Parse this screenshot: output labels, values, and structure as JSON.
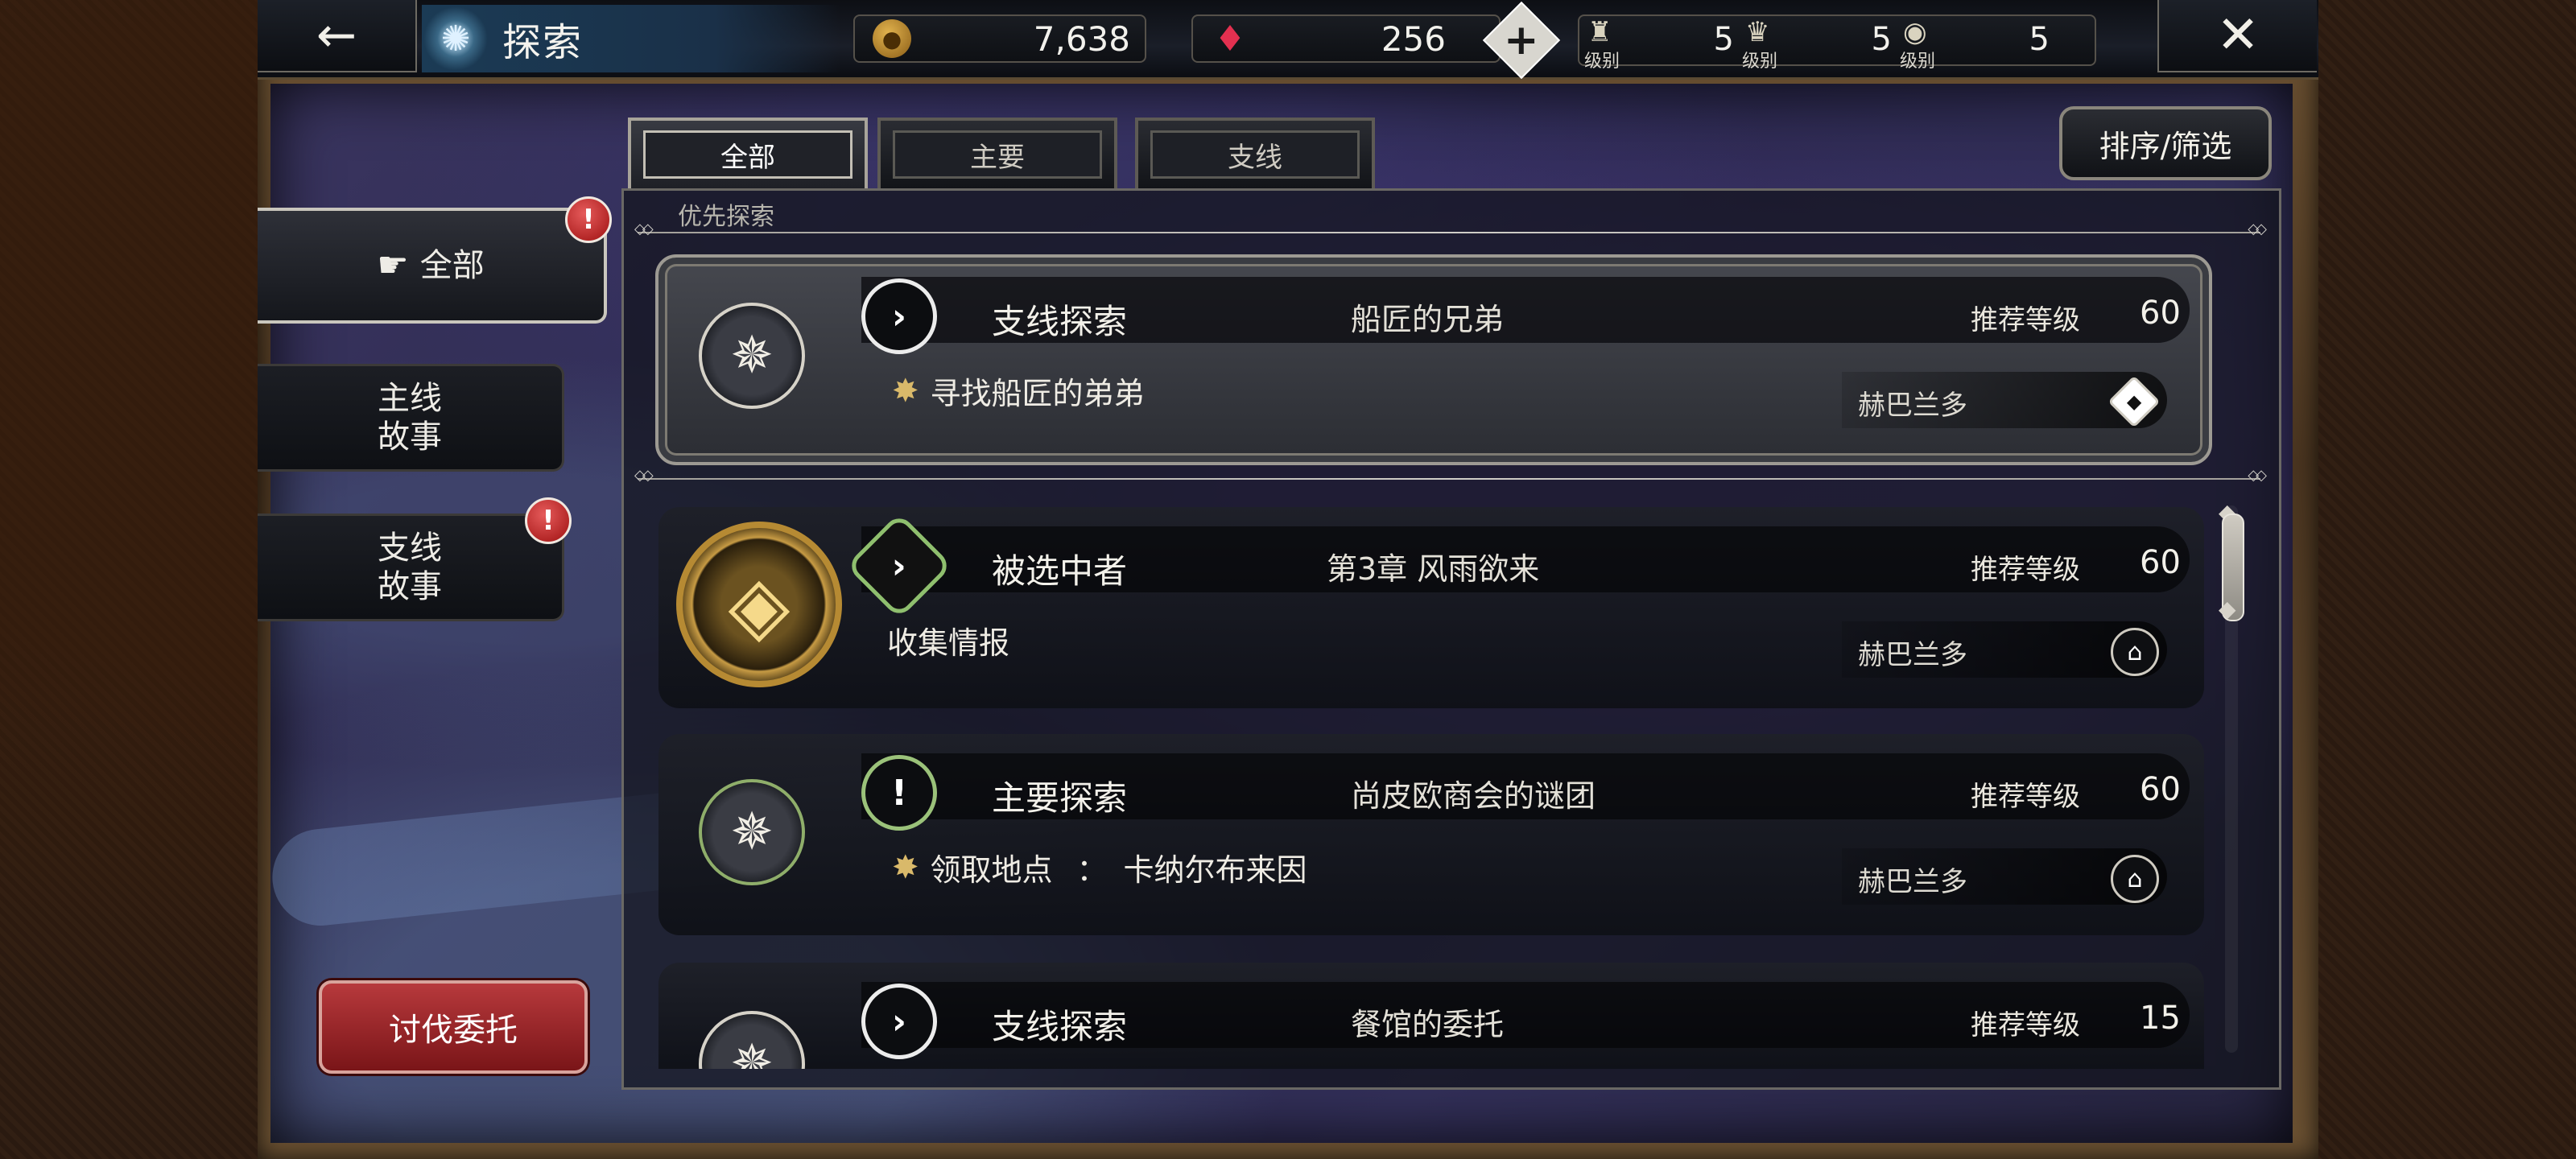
{
  "header": {
    "title": "探索",
    "back_icon": "←",
    "close_icon": "✕",
    "coins": "7,638",
    "gems": "256",
    "plus": "+",
    "ranks": [
      {
        "icon": "guild-rank-icon",
        "label": "级别",
        "value": "5"
      },
      {
        "icon": "crown-rank-icon",
        "label": "级别",
        "value": "5"
      },
      {
        "icon": "eye-rank-icon",
        "label": "级别",
        "value": "5"
      }
    ]
  },
  "sidebar": {
    "items": [
      {
        "label": "全部",
        "active": true,
        "alert": true
      },
      {
        "label_line1": "主线",
        "label_line2": "故事",
        "alert": false
      },
      {
        "label_line1": "支线",
        "label_line2": "故事",
        "alert": true
      }
    ],
    "alert_mark": "!",
    "subjugate_button": "讨伐委托"
  },
  "tabs": [
    {
      "label": "全部",
      "active": true
    },
    {
      "label": "主要",
      "active": false
    },
    {
      "label": "支线",
      "active": false
    }
  ],
  "sort_button": "排序/筛选",
  "priority_label": "优先探索",
  "quests": [
    {
      "featured": true,
      "type": "支线探索",
      "name": "船匠的兄弟",
      "recommended_label": "推荐等级",
      "recommended_level": "60",
      "objective": "寻找船匠的弟弟",
      "location": "赫巴兰多"
    },
    {
      "featured": false,
      "type": "被选中者",
      "name": "第3章  风雨欲来",
      "recommended_label": "推荐等级",
      "recommended_level": "60",
      "objective": "收集情报",
      "location": "赫巴兰多"
    },
    {
      "featured": false,
      "type": "主要探索",
      "name": "尚皮欧商会的谜团",
      "recommended_label": "推荐等级",
      "recommended_level": "60",
      "objective_label": "领取地点",
      "objective_sep": "：",
      "objective_value": "卡纳尔布来因",
      "location": "赫巴兰多"
    },
    {
      "featured": false,
      "type": "支线探索",
      "name": "餐馆的委托",
      "recommended_label": "推荐等级",
      "recommended_level": "15"
    }
  ],
  "colors": {
    "accent_gold": "#b68a33",
    "alert_red": "#c62828",
    "subjugate_red": "#9e2528",
    "panel_border": "#9d9a93"
  }
}
